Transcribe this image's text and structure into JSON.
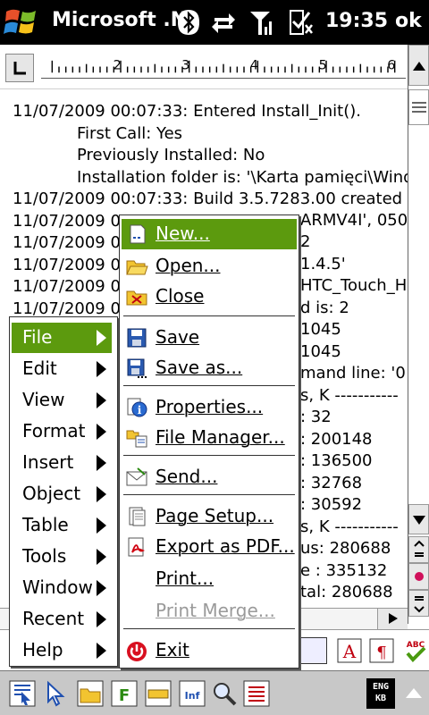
{
  "titlebar": {
    "app_title": "Microsoft .N",
    "clock": "19:35",
    "ok_label": "ok"
  },
  "document": {
    "lines": [
      "11/07/2009 00:07:33: Entered Install_Init().",
      "First Call: Yes",
      "Previously Installed: No",
      "Installation folder is: '\\Karta pamięci\\Wind",
      "11/07/2009 00:07:33: Build 3.5.7283.00 created o",
      "11/07/2009 0",
      "11/07/2009 0",
      "11/07/2009 0",
      "11/07/2009 0",
      "11/07/2009 0"
    ],
    "right_fragments": [
      "ARMV4I', 050",
      "2",
      "1.4.5'",
      "HTC_Touch_H",
      "d is: 2",
      "1045",
      "1045",
      "mand line: '0",
      "s, K -----------",
      ": 32",
      ": 200148",
      ": 136500",
      ": 32768",
      ": 30592",
      "s, K -----------",
      "us: 280688",
      "e  : 335132",
      "tal: 280688"
    ]
  },
  "main_menu": {
    "items": [
      {
        "label": "File",
        "selected": true
      },
      {
        "label": "Edit"
      },
      {
        "label": "View"
      },
      {
        "label": "Format"
      },
      {
        "label": "Insert"
      },
      {
        "label": "Object"
      },
      {
        "label": "Table"
      },
      {
        "label": "Tools"
      },
      {
        "label": "Window"
      },
      {
        "label": "Recent"
      },
      {
        "label": "Help"
      }
    ]
  },
  "file_menu": {
    "items": [
      {
        "label": "New...",
        "icon": "new-document-icon",
        "selected": true
      },
      {
        "label": "Open...",
        "icon": "folder-open-icon"
      },
      {
        "label": "Close",
        "icon": "close-folder-icon"
      },
      {
        "label": "Save",
        "icon": "floppy-disk-icon"
      },
      {
        "label": "Save as...",
        "icon": "floppy-save-as-icon"
      },
      {
        "label": "Properties...",
        "icon": "info-icon"
      },
      {
        "label": "File Manager...",
        "icon": "file-manager-icon"
      },
      {
        "label": "Send...",
        "icon": "envelope-icon"
      },
      {
        "label": "Page Setup...",
        "icon": "page-setup-icon"
      },
      {
        "label": "Export as PDF...",
        "icon": "pdf-icon"
      },
      {
        "label": "Print...",
        "icon": ""
      },
      {
        "label": "Print Merge...",
        "icon": "",
        "disabled": true
      },
      {
        "label": "Exit",
        "icon": "power-icon"
      }
    ]
  },
  "status": {
    "input_indicator": "ENG\nKB"
  },
  "colors": {
    "selection": "#5c9a0e",
    "title_bg": "#000000"
  }
}
